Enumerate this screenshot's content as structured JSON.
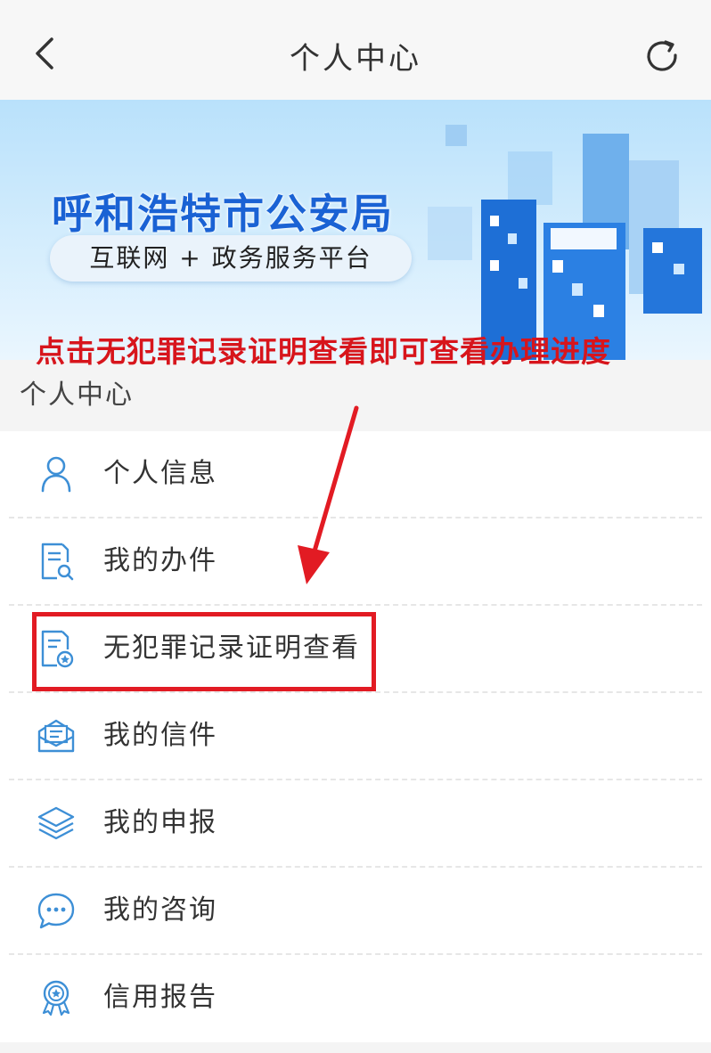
{
  "header": {
    "title": "个人中心",
    "back_icon": "chevron-left-icon",
    "refresh_icon": "refresh-icon"
  },
  "banner": {
    "org_name": "呼和浩特市公安局",
    "subtitle": "互联网 + 政务服务平台"
  },
  "annotation": {
    "text": "点击无犯罪记录证明查看即可查看办理进度",
    "color": "#d7151c"
  },
  "section": {
    "title": "个人中心"
  },
  "menu": {
    "items": [
      {
        "label": "个人信息",
        "icon": "user-icon"
      },
      {
        "label": "我的办件",
        "icon": "document-search-icon"
      },
      {
        "label": "无犯罪记录证明查看",
        "icon": "certificate-icon",
        "highlighted": true
      },
      {
        "label": "我的信件",
        "icon": "envelope-icon"
      },
      {
        "label": "我的申报",
        "icon": "layers-icon"
      },
      {
        "label": "我的咨询",
        "icon": "chat-bubble-icon"
      },
      {
        "label": "信用报告",
        "icon": "badge-icon"
      }
    ]
  },
  "colors": {
    "icon": "#3d8fd6",
    "brand": "#1a62d4",
    "highlight": "#e21b23"
  }
}
